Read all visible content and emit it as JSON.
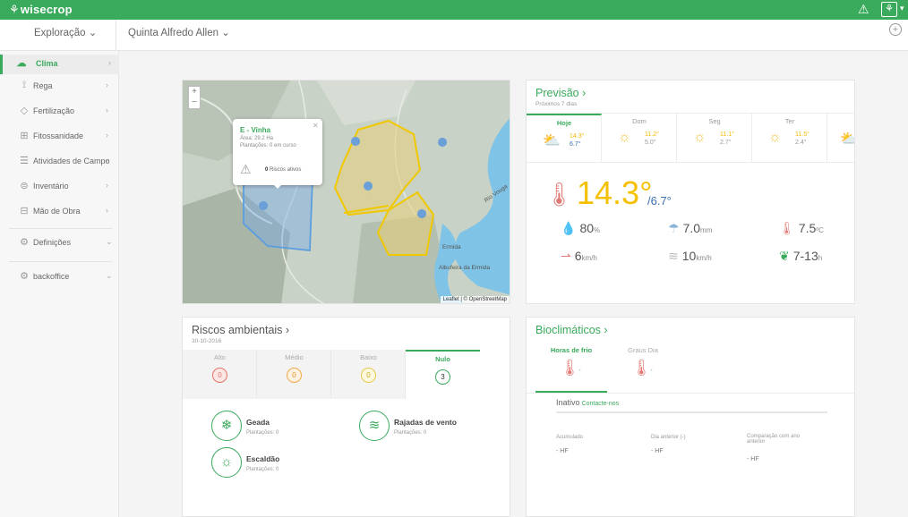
{
  "app": {
    "brand": "wisecrop"
  },
  "subbar": {
    "exploration": "Exploração ⌄",
    "farm": "Quinta Alfredo Allen ⌄"
  },
  "sidebar": {
    "items": [
      {
        "label": "Clima",
        "icon": "cloud-sun-icon"
      },
      {
        "label": "Rega",
        "icon": "sprinkler-icon"
      },
      {
        "label": "Fertilização",
        "icon": "fertilizer-icon"
      },
      {
        "label": "Fitossanidade",
        "icon": "plant-health-icon"
      },
      {
        "label": "Atividades de Campo",
        "icon": "activities-icon"
      },
      {
        "label": "Inventário",
        "icon": "inventory-icon"
      },
      {
        "label": "Mão de Obra",
        "icon": "labor-icon"
      },
      {
        "label": "Definições",
        "icon": "settings-icon"
      },
      {
        "label": "backoffice",
        "icon": "backoffice-icon"
      }
    ]
  },
  "map": {
    "popup": {
      "title": "E - Vinha",
      "area": "Área: 29.2 Ha",
      "plantations": "Plantações: 0 em curso",
      "risk_count": "0",
      "risk_label": "Riscos ativos"
    },
    "labels": {
      "ermida": "Ermida",
      "albufeira": "Albufeira da Ermida",
      "river": "Rio Vouga"
    },
    "attribution": "Leaflet | © OpenStreetMap"
  },
  "forecast": {
    "title": "Previsão",
    "subtitle": "Próximos 7 dias",
    "days": [
      {
        "day": "Hoje",
        "max": "14.3°",
        "min": "6.7°"
      },
      {
        "day": "Dom",
        "max": "11.2°",
        "min": "5.0°"
      },
      {
        "day": "Seg",
        "max": "11.1°",
        "min": "2.7°"
      },
      {
        "day": "Ter",
        "max": "11.5°",
        "min": "2.4°"
      }
    ],
    "today": {
      "temp": "14.3°",
      "temp_min": "/6.7°",
      "humidity": "80",
      "humidity_unit": "%",
      "precip": "7.0",
      "precip_unit": "mm",
      "thermal": "7.5",
      "thermal_unit": "ºC",
      "wind": "6",
      "wind_unit": "km/h",
      "gust": "10",
      "gust_unit": "km/h",
      "hours": "7-13",
      "hours_unit": "h"
    }
  },
  "risks": {
    "title": "Riscos ambientais",
    "date": "30-10-2016",
    "levels": [
      {
        "name": "Alto",
        "count": "0",
        "color": "#e0736c"
      },
      {
        "name": "Médio",
        "count": "0",
        "color": "#f0a94a"
      },
      {
        "name": "Baixo",
        "count": "0",
        "color": "#e6c84a"
      },
      {
        "name": "Nulo",
        "count": "3",
        "color": "#3aaa5c"
      }
    ],
    "items": [
      {
        "name": "Geada",
        "sub": "Plantações: 0"
      },
      {
        "name": "Rajadas de vento",
        "sub": "Plantações: 0"
      },
      {
        "name": "Escaldão",
        "sub": "Plantações: 0"
      }
    ]
  },
  "bio": {
    "title": "Bioclimáticos",
    "tabs": [
      {
        "name": "Horas de frio"
      },
      {
        "name": "Graus Dia"
      }
    ],
    "inactive": "Inativo",
    "contact": "Contacte-nos",
    "stats": [
      {
        "label": "Acumulado",
        "value": "- HF"
      },
      {
        "label": "Dia anterior (-)",
        "value": "- HF"
      },
      {
        "label": "Comparação com ano anterior",
        "value": "- HF"
      }
    ]
  }
}
